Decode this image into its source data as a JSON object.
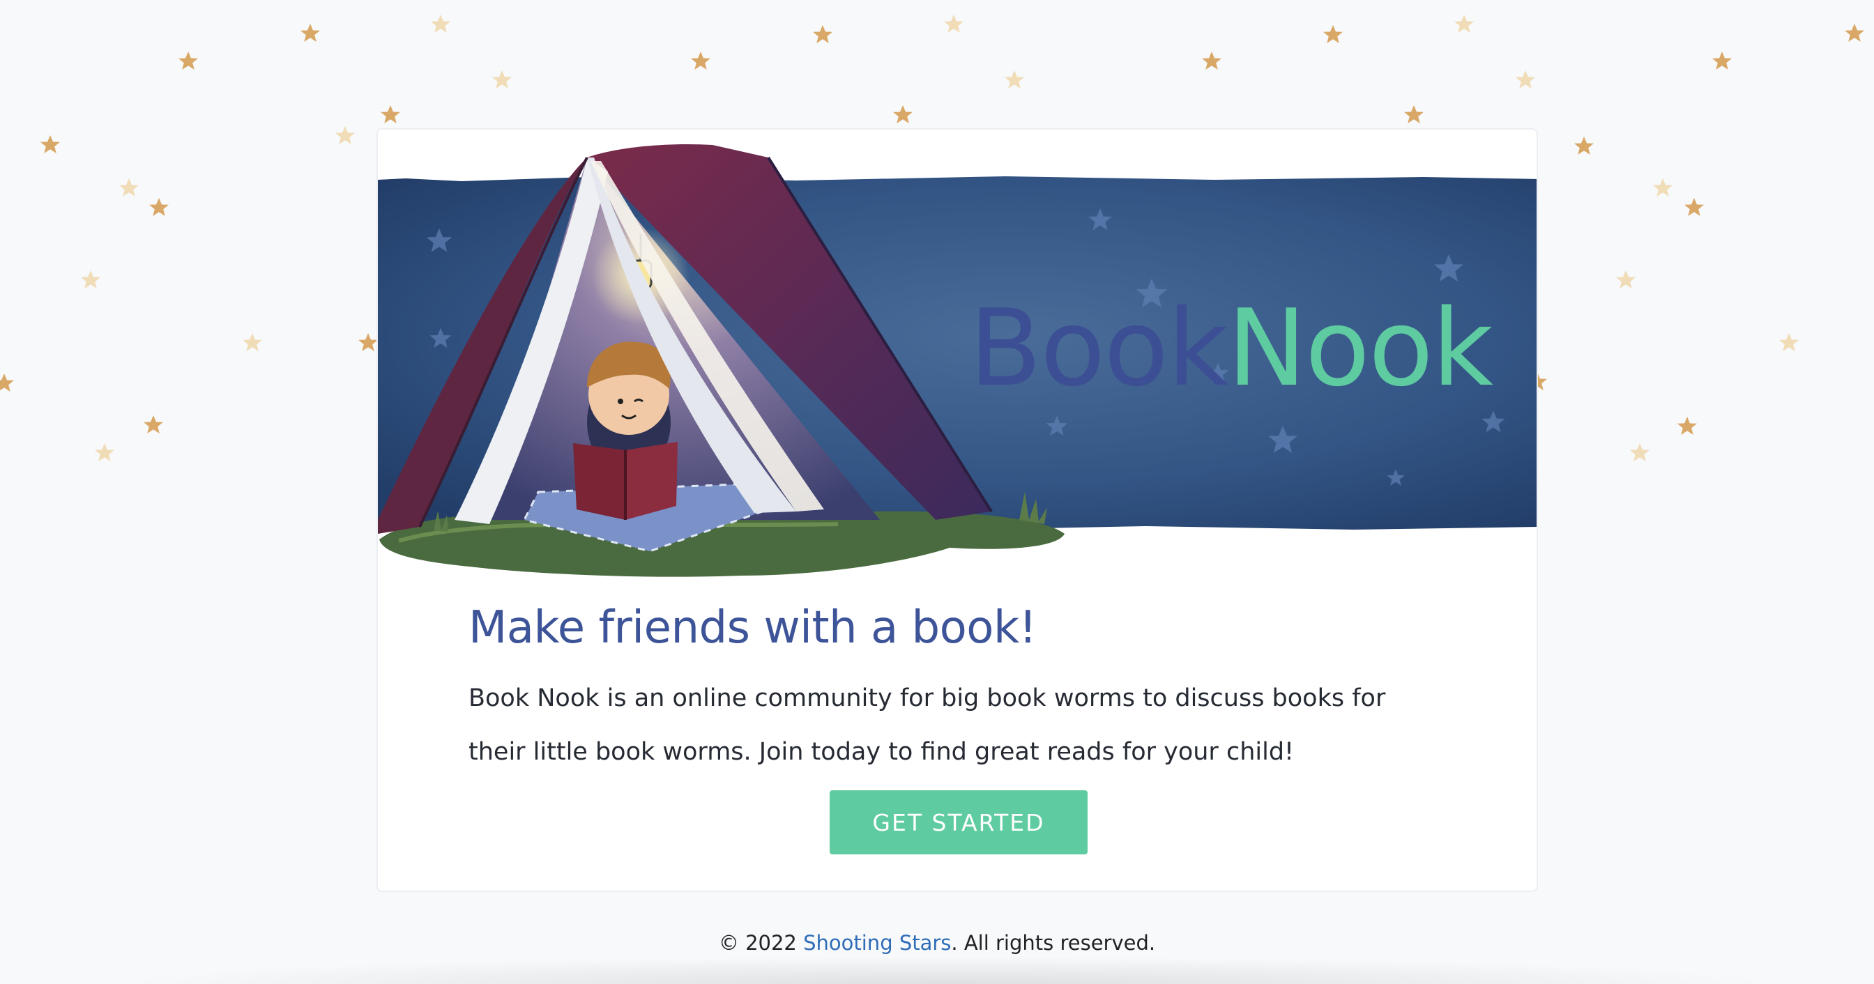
{
  "brand": {
    "part1": "Book",
    "part2": "Nook"
  },
  "main": {
    "headline": "Make friends with a book!",
    "description": "Book Nook is an online community for big book worms to discuss books for their little book worms. Join today to find great reads for your child!",
    "cta_label": "GET STARTED"
  },
  "footer": {
    "prefix": "© 2022 ",
    "link_text": "Shooting Stars",
    "suffix": ". All rights reserved."
  },
  "colors": {
    "brand_blue": "#3d4f94",
    "brand_green": "#5ecba1",
    "banner_blue": "#2c4a78",
    "star_gold": "#d9a867",
    "link_blue": "#2f6db8"
  },
  "icons": {
    "background": "star-icon",
    "hero": "book-tent-illustration"
  }
}
